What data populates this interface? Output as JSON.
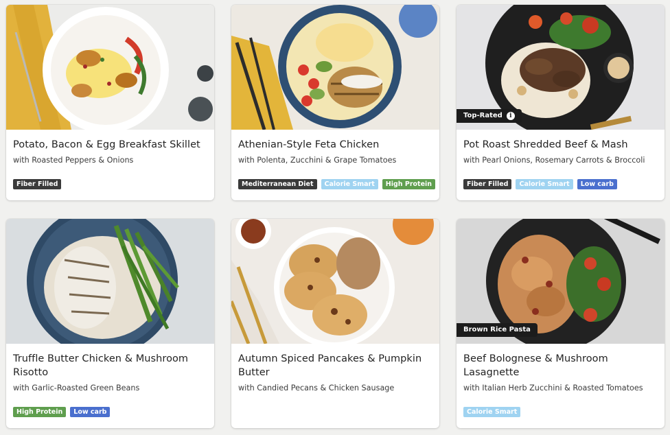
{
  "colors": {
    "page_bg": "#f1f1ef",
    "tag_dark": "#3a3a3a",
    "tag_light_blue": "#9fd3f1",
    "tag_green": "#5f9e4e",
    "tag_blue": "#4a6fce",
    "badge_bg": "#1c1c1c"
  },
  "meals": [
    {
      "title": "Potato, Bacon & Egg Breakfast Skillet",
      "subtitle": "with Roasted Peppers & Onions",
      "badge": "",
      "tags": [
        {
          "label": "Fiber Filled",
          "color": "#3a3a3a"
        }
      ]
    },
    {
      "title": "Athenian-Style Feta Chicken",
      "subtitle": "with Polenta, Zucchini & Grape Tomatoes",
      "badge": "",
      "tags": [
        {
          "label": "Mediterranean Diet",
          "color": "#3a3a3a"
        },
        {
          "label": "Calorie Smart",
          "color": "#9fd3f1"
        },
        {
          "label": "High Protein",
          "color": "#5f9e4e"
        }
      ]
    },
    {
      "title": "Pot Roast Shredded Beef & Mash",
      "subtitle": "with Pearl Onions, Rosemary Carrots & Broccoli",
      "badge": "Top-Rated",
      "badge_icon": "info-icon",
      "tags": [
        {
          "label": "Fiber Filled",
          "color": "#3a3a3a"
        },
        {
          "label": "Calorie Smart",
          "color": "#9fd3f1"
        },
        {
          "label": "Low carb",
          "color": "#4a6fce"
        }
      ]
    },
    {
      "title": "Truffle Butter Chicken & Mushroom Risotto",
      "subtitle": "with Garlic-Roasted Green Beans",
      "badge": "",
      "tags": [
        {
          "label": "High Protein",
          "color": "#5f9e4e"
        },
        {
          "label": "Low carb",
          "color": "#4a6fce"
        }
      ]
    },
    {
      "title": "Autumn Spiced Pancakes & Pumpkin Butter",
      "subtitle": "with Candied Pecans & Chicken Sausage",
      "badge": "",
      "tags": []
    },
    {
      "title": "Beef Bolognese & Mushroom Lasagnette",
      "subtitle": "with Italian Herb Zucchini & Roasted Tomatoes",
      "badge": "Brown Rice Pasta",
      "tags": [
        {
          "label": "Calorie Smart",
          "color": "#9fd3f1"
        }
      ]
    }
  ]
}
